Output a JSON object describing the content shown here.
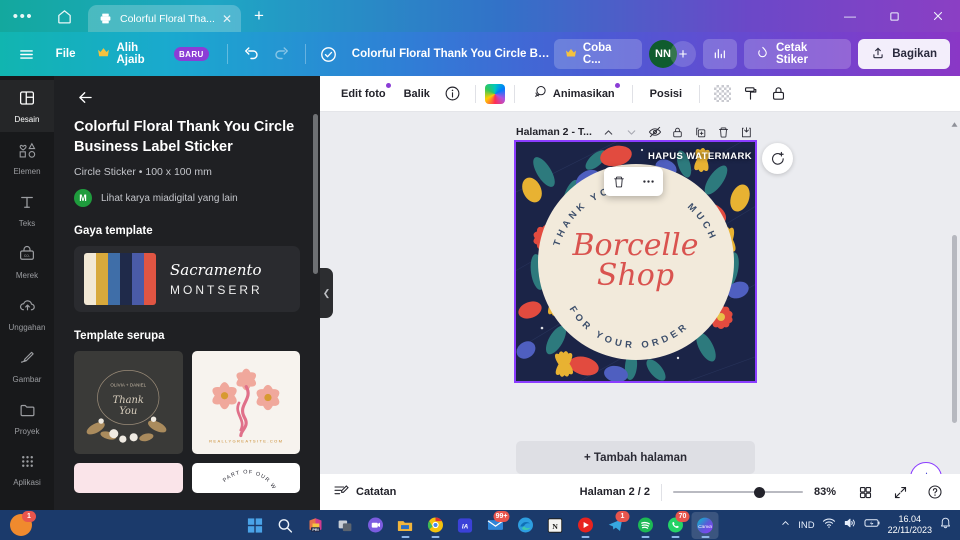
{
  "browser": {
    "menu_icon": "ellipsis-icon",
    "home_icon": "home-icon",
    "tab_title": "Colorful Floral Tha...",
    "tab_favicon": "printer-icon",
    "close_icon": "close-icon",
    "new_tab_icon": "plus-icon",
    "window_minimize": "minimize-icon",
    "window_maximize": "maximize-icon",
    "window_close": "close-icon"
  },
  "toolbar": {
    "hamburger": "hamburger-icon",
    "file_label": "File",
    "magic_label": "Alih Ajaib",
    "magic_badge": "BARU",
    "undo_icon": "undo-icon",
    "redo_icon": "redo-icon",
    "cloud_icon": "cloud-saved-icon",
    "doc_title": "Colorful Floral Thank You Circle Busi...",
    "try_canva_label": "Coba C...",
    "avatar_initials": "NN",
    "invite_icon": "plus-icon",
    "insights_icon": "bar-chart-icon",
    "print_label": "Cetak Stiker",
    "share_label": "Bagikan",
    "share_icon": "upload-icon"
  },
  "rail": {
    "items": [
      {
        "label": "Desain",
        "icon": "layout-icon",
        "active": true
      },
      {
        "label": "Elemen",
        "icon": "shapes-icon",
        "active": false
      },
      {
        "label": "Teks",
        "icon": "text-t-icon",
        "active": false
      },
      {
        "label": "Merek",
        "icon": "brand-kit-icon",
        "active": false
      },
      {
        "label": "Unggahan",
        "icon": "upload-cloud-icon",
        "active": false
      },
      {
        "label": "Gambar",
        "icon": "draw-pen-icon",
        "active": false
      },
      {
        "label": "Proyek",
        "icon": "folder-icon",
        "active": false
      },
      {
        "label": "Aplikasi",
        "icon": "apps-grid-icon",
        "active": false
      }
    ]
  },
  "panel": {
    "back_icon": "arrow-left-icon",
    "title": "Colorful Floral Thank You Circle Business Label Sticker",
    "subtitle": "Circle Sticker • 100 x 100 mm",
    "author_initial": "M",
    "author_text": "Lihat karya miadigital yang lain",
    "style_heading": "Gaya template",
    "style_card": {
      "swatches": [
        "#f2e8d5",
        "#d8a93c",
        "#3f6ea8",
        "#1f2a4a",
        "#4a5ba8",
        "#e05543"
      ],
      "font_script": "Sacramento",
      "font_sans": "MONTSERR"
    },
    "similar_heading": "Template serupa",
    "templates": [
      {
        "name": "thank-you-wreath",
        "caption": "OLIVIA + DANIEL Thank You"
      },
      {
        "name": "pink-floral-circle",
        "caption": "REALLYGREATSITE.COM"
      },
      {
        "name": "pink-blush-label",
        "caption": ""
      },
      {
        "name": "wedding-arch-label",
        "caption": "PART OF OUR WEDD"
      }
    ]
  },
  "editor_toolbar": {
    "edit_photo_label": "Edit foto",
    "flip_label": "Balik",
    "info_icon": "info-icon",
    "color_swatch": "rainbow-gradient-swatch",
    "animate_label": "Animasikan",
    "animate_icon": "animate-icon",
    "position_label": "Posisi",
    "transparency_icon": "transparency-icon",
    "copy_style_icon": "paint-roller-icon",
    "lock_icon": "lock-icon"
  },
  "canvas": {
    "page_header": "Halaman 2 - T...",
    "header_icons": [
      "chevron-up-icon",
      "chevron-down-icon",
      "hide-page-icon",
      "lock-page-icon",
      "duplicate-page-icon",
      "delete-page-icon",
      "add-page-icon"
    ],
    "watermark": "HAPUS WATERMARK",
    "sticker": {
      "arc_top_left": "THANK YOU SO",
      "arc_top_right": "MUCH",
      "brand_line1": "Borcelle",
      "brand_line2": "Shop",
      "arc_bottom": "FOR YOUR ORDER",
      "disc_color": "#f2eadb",
      "brand_color": "#d9534f",
      "background_color": "#1b2447"
    },
    "element_toolbar": [
      "delete-icon",
      "more-options-icon"
    ],
    "comment_icon": "add-comment-icon",
    "add_page_label": "+ Tambah halaman",
    "magic_icon": "magic-sparkle-icon"
  },
  "status_bar": {
    "notes_label": "Catatan",
    "notes_icon": "notes-icon",
    "page_indicator": "Halaman 2 / 2",
    "zoom_value": "83%",
    "grid_icon": "grid-view-icon",
    "fullscreen_icon": "expand-icon",
    "help_icon": "help-icon"
  },
  "taskbar": {
    "apps": [
      {
        "name": "start",
        "icon": "windows-logo-icon",
        "badge": "",
        "running": false
      },
      {
        "name": "search",
        "icon": "search-icon",
        "badge": "",
        "running": false
      },
      {
        "name": "office",
        "icon": "office-icon",
        "badge": "",
        "running": false
      },
      {
        "name": "task-view",
        "icon": "task-view-icon",
        "badge": "",
        "running": false
      },
      {
        "name": "teams",
        "icon": "teams-icon",
        "badge": "",
        "running": false
      },
      {
        "name": "file-explorer",
        "icon": "folder-icon",
        "badge": "",
        "running": true
      },
      {
        "name": "chrome",
        "icon": "chrome-icon",
        "badge": "",
        "running": true
      },
      {
        "name": "ia-app",
        "icon": "ia-icon",
        "badge": "",
        "running": false
      },
      {
        "name": "mail",
        "icon": "mail-icon",
        "badge": "99+",
        "running": false
      },
      {
        "name": "edge",
        "icon": "edge-icon",
        "badge": "",
        "running": false
      },
      {
        "name": "notion",
        "icon": "notion-icon",
        "badge": "",
        "running": false
      },
      {
        "name": "youtube-music",
        "icon": "youtube-music-icon",
        "badge": "",
        "running": true
      },
      {
        "name": "telegram",
        "icon": "telegram-icon",
        "badge": "1",
        "running": false
      },
      {
        "name": "spotify",
        "icon": "spotify-icon",
        "badge": "",
        "running": true
      },
      {
        "name": "whatsapp",
        "icon": "whatsapp-icon",
        "badge": "70",
        "running": true
      },
      {
        "name": "canva",
        "icon": "canva-icon",
        "badge": "",
        "running": true
      }
    ],
    "notification_badge": "1",
    "tray": {
      "expand_icon": "chevron-up-icon",
      "language": "IND",
      "wifi_icon": "wifi-icon",
      "volume_icon": "volume-icon",
      "battery_icon": "battery-charging-icon",
      "time": "16.04",
      "date": "22/11/2023",
      "bell_icon": "bell-icon"
    }
  }
}
